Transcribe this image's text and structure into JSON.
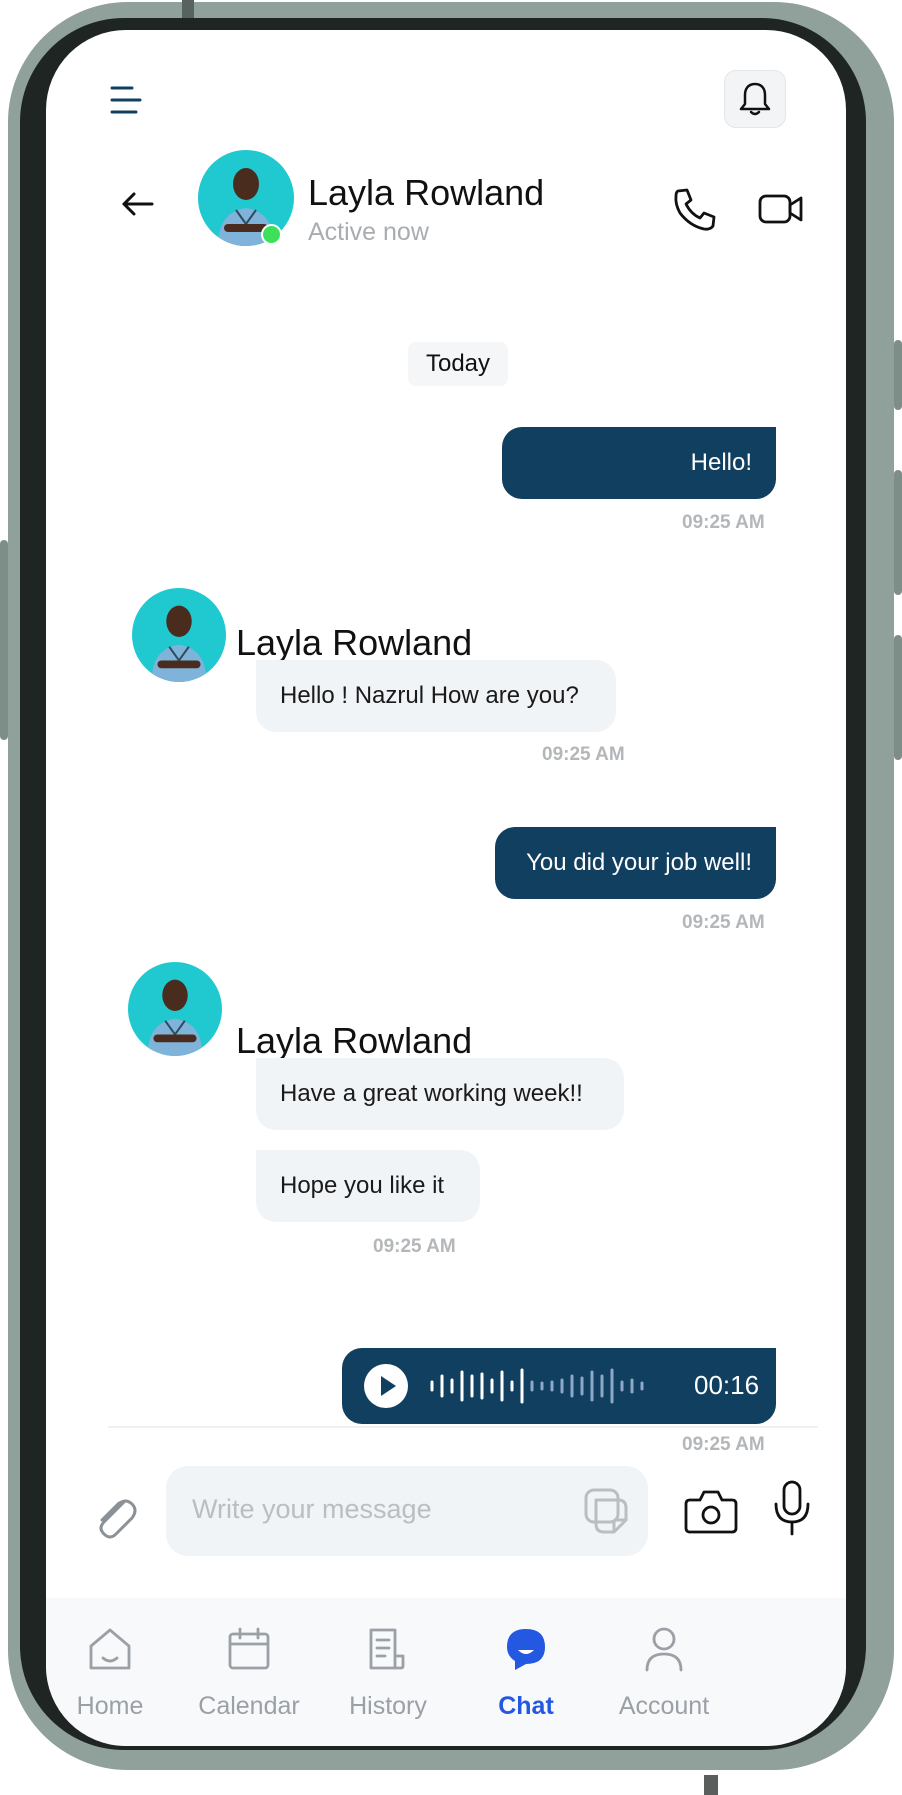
{
  "header": {
    "contact_name": "Layla Rowland",
    "contact_status": "Active now"
  },
  "date_separator": "Today",
  "messages": [
    {
      "direction": "outgoing",
      "text": "Hello!",
      "time": "09:25 AM"
    },
    {
      "direction": "incoming",
      "sender": "Layla Rowland",
      "text": "Hello ! Nazrul How are you?",
      "time": "09:25 AM"
    },
    {
      "direction": "outgoing",
      "text": "You did your job well!",
      "time": "09:25 AM"
    },
    {
      "direction": "incoming",
      "sender": "Layla Rowland",
      "texts": [
        "Have a great working week!!",
        "Hope you like it"
      ],
      "time": "09:25 AM"
    },
    {
      "direction": "outgoing",
      "type": "voice",
      "duration": "00:16",
      "time": "09:25 AM"
    }
  ],
  "composer": {
    "placeholder": "Write your message"
  },
  "bottom_nav": [
    {
      "label": "Home",
      "icon": "home-icon"
    },
    {
      "label": "Calendar",
      "icon": "calendar-icon"
    },
    {
      "label": "History",
      "icon": "history-icon"
    },
    {
      "label": "Chat",
      "icon": "chat-icon",
      "active": true
    },
    {
      "label": "Account",
      "icon": "account-icon"
    }
  ],
  "colors": {
    "accent": "#2458e0",
    "outgoing_bubble": "#103f60",
    "incoming_bubble": "#f1f4f7",
    "avatar_bg": "#1fc9cf",
    "online": "#3ee05a"
  }
}
